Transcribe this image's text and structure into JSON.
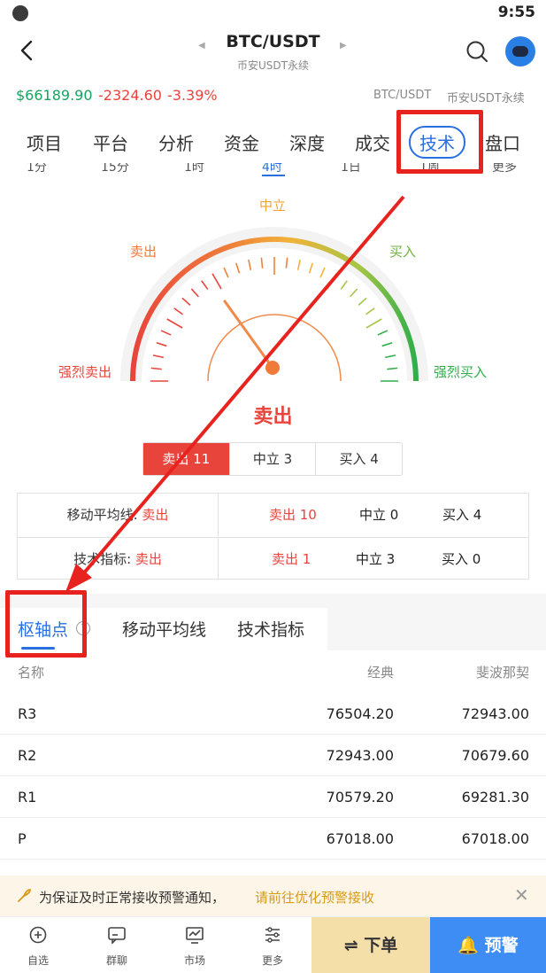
{
  "status": {
    "time": "9:55"
  },
  "header": {
    "pair": "BTC/USDT",
    "subtitle": "币安USDT永续"
  },
  "price": {
    "last": "$66189.90",
    "change": "-2324.60",
    "percent": "-3.39%",
    "right_pair": "BTC/USDT",
    "right_market": "币安USDT永续"
  },
  "tabs": [
    "项目",
    "平台",
    "分析",
    "资金",
    "深度",
    "成交",
    "技术",
    "盘口"
  ],
  "timeframes": [
    "1分",
    "15分",
    "1时",
    "4时",
    "1日",
    "1周",
    "更多"
  ],
  "gauge": {
    "labels": {
      "neutral": "中立",
      "sell": "卖出",
      "buy": "买入",
      "strong_sell": "强烈卖出",
      "strong_buy": "强烈买入"
    },
    "needle_position": "sell",
    "verdict": "卖出"
  },
  "summary_counts": {
    "sell": "卖出 11",
    "neutral": "中立 3",
    "buy": "买入 4"
  },
  "summary_table": [
    {
      "label": "移动平均线: ",
      "value": "卖出",
      "sell": "卖出 10",
      "neutral": "中立 0",
      "buy": "买入 4"
    },
    {
      "label": "技术指标: ",
      "value": "卖出",
      "sell": "卖出 1",
      "neutral": "中立 3",
      "buy": "买入 0"
    }
  ],
  "sub_tabs": [
    "枢轴点",
    "移动平均线",
    "技术指标"
  ],
  "pivot": {
    "headers": {
      "name": "名称",
      "classic": "经典",
      "fib": "斐波那契"
    },
    "rows": [
      {
        "name": "R3",
        "classic": "76504.20",
        "fib": "72943.00"
      },
      {
        "name": "R2",
        "classic": "72943.00",
        "fib": "70679.60"
      },
      {
        "name": "R1",
        "classic": "70579.20",
        "fib": "69281.30"
      },
      {
        "name": "P",
        "classic": "67018.00",
        "fib": "67018.00"
      }
    ]
  },
  "notice": {
    "text": "为保证及时正常接收预警通知，",
    "link": "请前往优化预警接收"
  },
  "bottom_nav": {
    "items": [
      "自选",
      "群聊",
      "市场",
      "更多"
    ],
    "order": "⇌ 下单",
    "alert": "🔔 预警"
  },
  "colors": {
    "up": "#1aa260",
    "down": "#e8443c",
    "accent": "#2a6fe0",
    "highlight": "#e8231f"
  }
}
